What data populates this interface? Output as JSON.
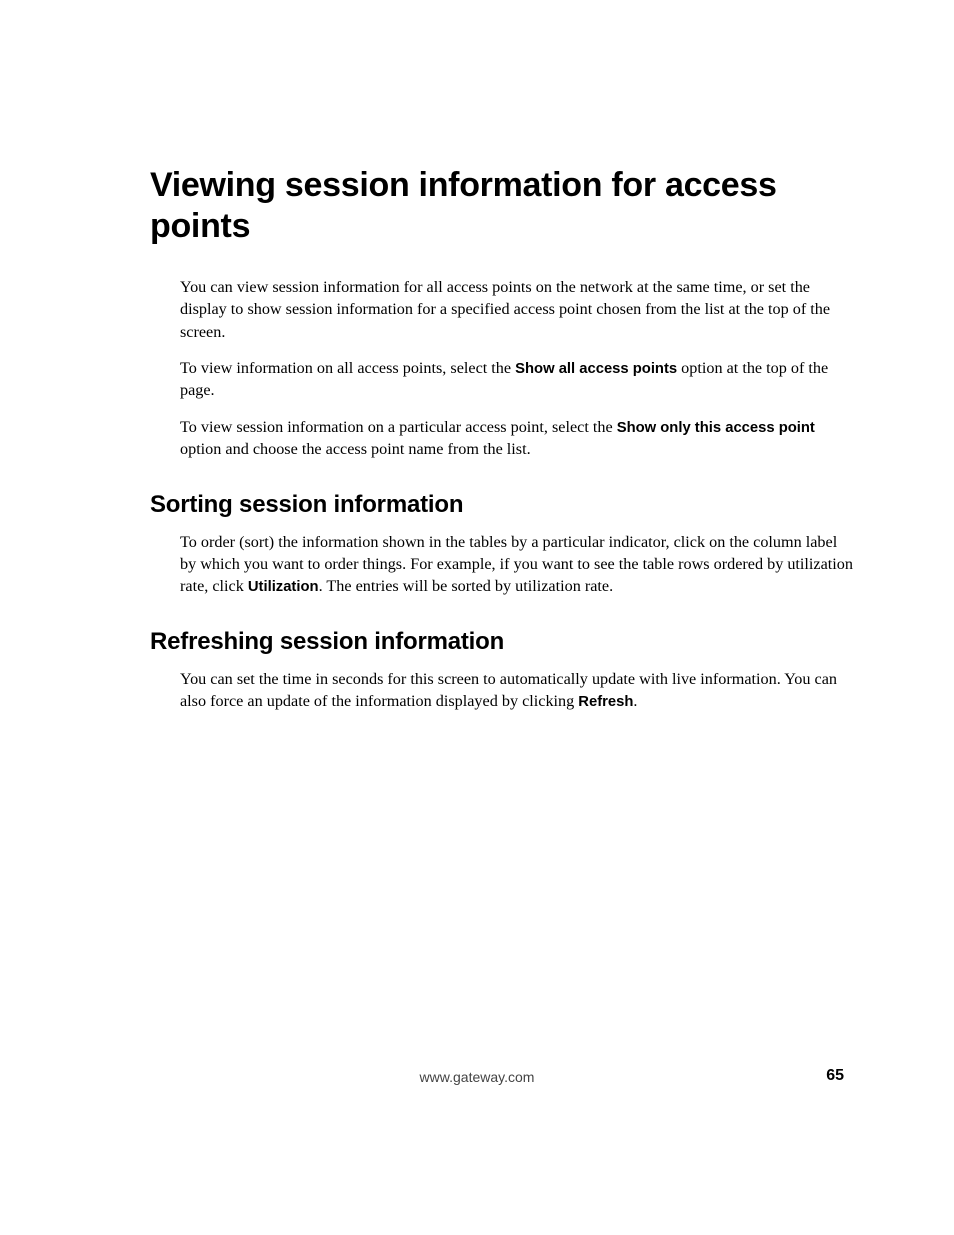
{
  "heading_main": "Viewing session information for access points",
  "para1": "You can view session information for all access points on the network at the same time, or set the display to show session information for a specified access point chosen from the list at the top of the screen.",
  "para2_a": "To view information on all access points, select the ",
  "para2_bold": "Show all access points",
  "para2_b": " option at the top of the page.",
  "para3_a": "To view session information on a particular access point, select the ",
  "para3_bold": "Show only this access point",
  "para3_b": " option and choose the access point name from the list.",
  "heading_sort": "Sorting session information",
  "para_sort_a": "To order (sort) the information shown in the tables by a particular indicator, click on the column label by which you want to order things. For example, if you want to see the table rows ordered by utilization rate, click ",
  "para_sort_bold": "Utilization",
  "para_sort_b": ". The entries will be sorted by utilization rate.",
  "heading_refresh": "Refreshing session information",
  "para_refresh_a": "You can set the time in seconds for this screen to automatically update with live information. You can also force an update of the information displayed by clicking ",
  "para_refresh_bold": "Refresh",
  "para_refresh_b": ".",
  "footer_url": "www.gateway.com",
  "page_number": "65"
}
